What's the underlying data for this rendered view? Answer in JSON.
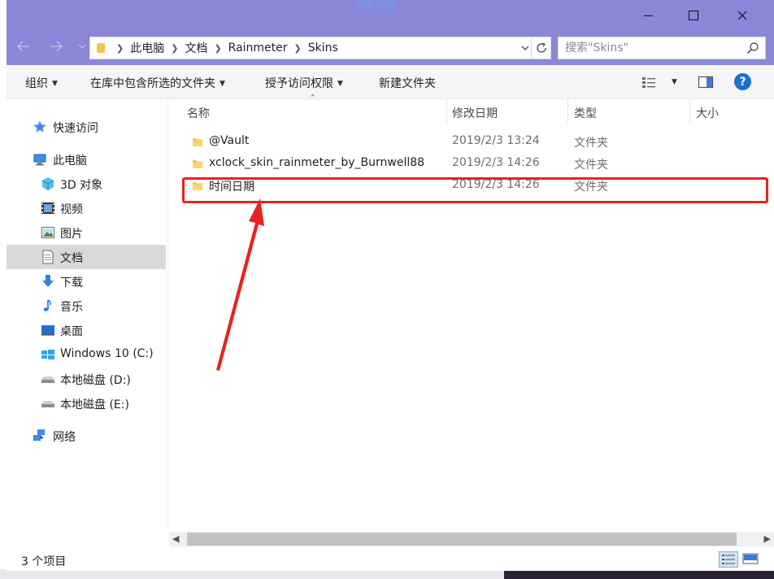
{
  "window": {
    "title": "网易截图"
  },
  "address": {
    "crumbs": [
      "此电脑",
      "文档",
      "Rainmeter",
      "Skins"
    ]
  },
  "search": {
    "placeholder": "搜索\"Skins\""
  },
  "toolbar": {
    "organize": "组织",
    "include_in_library": "在库中包含所选的文件夹",
    "grant_access": "授予访问权限",
    "new_folder": "新建文件夹"
  },
  "sidebar": {
    "quick_access": "快速访问",
    "this_pc": "此电脑",
    "objects_3d": "3D 对象",
    "videos": "视频",
    "pictures": "图片",
    "documents": "文档",
    "downloads": "下载",
    "music": "音乐",
    "desktop": "桌面",
    "drive_c": "Windows 10 (C:)",
    "drive_d": "本地磁盘 (D:)",
    "drive_e": "本地磁盘 (E:)",
    "network": "网络"
  },
  "columns": {
    "name": "名称",
    "modified": "修改日期",
    "type": "类型",
    "size": "大小"
  },
  "files": [
    {
      "name": "@Vault",
      "modified": "2019/2/3 13:24",
      "type": "文件夹"
    },
    {
      "name": "xclock_skin_rainmeter_by_Burnwell88",
      "modified": "2019/2/3 14:26",
      "type": "文件夹"
    },
    {
      "name": "时间日期",
      "modified": "2019/2/3 14:26",
      "type": "文件夹"
    }
  ],
  "status": {
    "item_count": "3 个项目"
  },
  "colors": {
    "title_bar": "#8a86d8",
    "folder": "#f3c54c",
    "highlight": "#e8231f",
    "selected_nav": "#d9d9d9"
  },
  "icons": {
    "title_buttons": [
      "minimize-icon",
      "maximize-icon",
      "close-icon"
    ],
    "nav": [
      "back-arrow-icon",
      "forward-arrow-icon",
      "recent-dropdown-icon",
      "refresh-icon",
      "search-icon",
      "help-icon"
    ]
  }
}
